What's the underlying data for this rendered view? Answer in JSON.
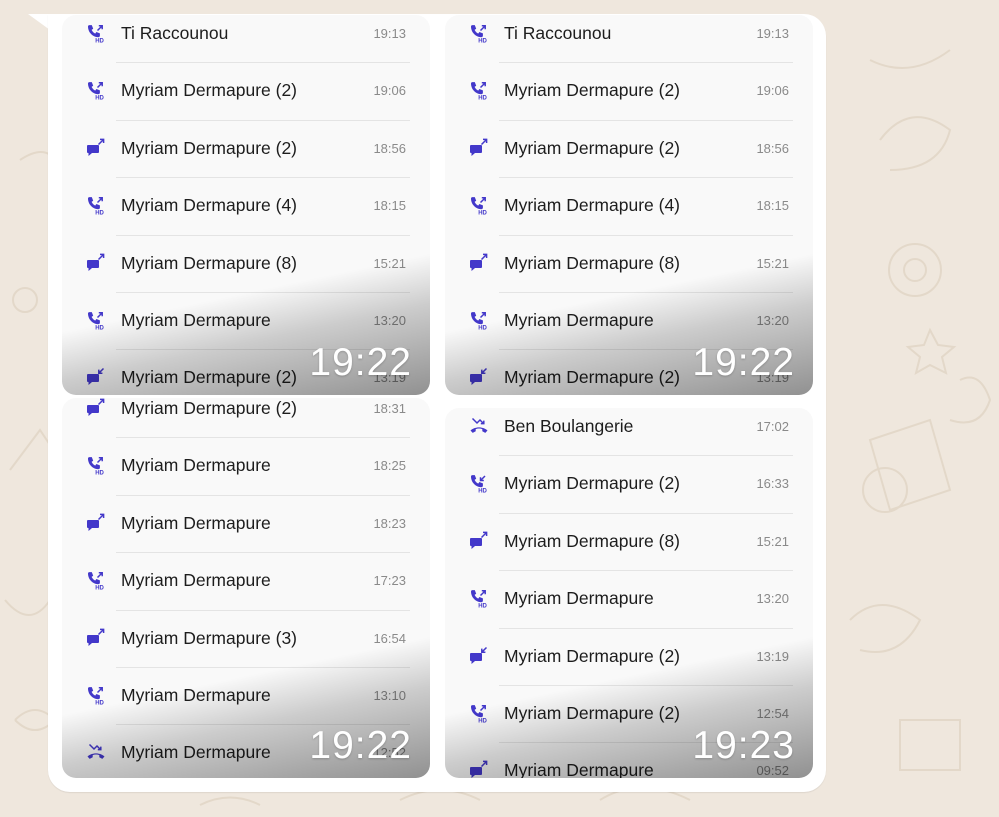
{
  "colors": {
    "accent": "#4338ca",
    "wallpaper": "#efe7dd",
    "bubble": "#ffffff"
  },
  "screenshots": [
    {
      "timestamp": "19:22",
      "rows": [
        {
          "icon": "hd-call-outgoing-icon",
          "name": "Ti Raccounou",
          "time": "19:13"
        },
        {
          "icon": "hd-call-outgoing-icon",
          "name": "Myriam Dermapure (2)",
          "time": "19:06"
        },
        {
          "icon": "message-outgoing-icon",
          "name": "Myriam Dermapure (2)",
          "time": "18:56"
        },
        {
          "icon": "hd-call-outgoing-icon",
          "name": "Myriam Dermapure (4)",
          "time": "18:15"
        },
        {
          "icon": "message-outgoing-icon",
          "name": "Myriam Dermapure (8)",
          "time": "15:21"
        },
        {
          "icon": "hd-call-outgoing-icon",
          "name": "Myriam Dermapure",
          "time": "13:20"
        },
        {
          "icon": "message-incoming-icon",
          "name": "Myriam Dermapure (2)",
          "time": "13:19"
        }
      ]
    },
    {
      "timestamp": "19:22",
      "rows": [
        {
          "icon": "hd-call-outgoing-icon",
          "name": "Ti Raccounou",
          "time": "19:13"
        },
        {
          "icon": "hd-call-outgoing-icon",
          "name": "Myriam Dermapure (2)",
          "time": "19:06"
        },
        {
          "icon": "message-outgoing-icon",
          "name": "Myriam Dermapure (2)",
          "time": "18:56"
        },
        {
          "icon": "hd-call-outgoing-icon",
          "name": "Myriam Dermapure (4)",
          "time": "18:15"
        },
        {
          "icon": "message-outgoing-icon",
          "name": "Myriam Dermapure (8)",
          "time": "15:21"
        },
        {
          "icon": "hd-call-outgoing-icon",
          "name": "Myriam Dermapure",
          "time": "13:20"
        },
        {
          "icon": "message-incoming-icon",
          "name": "Myriam Dermapure (2)",
          "time": "13:19"
        }
      ]
    },
    {
      "timestamp": "19:22",
      "rows": [
        {
          "icon": "message-outgoing-icon",
          "name": "Myriam Dermapure (2)",
          "time": "18:31"
        },
        {
          "icon": "hd-call-outgoing-icon",
          "name": "Myriam Dermapure",
          "time": "18:25"
        },
        {
          "icon": "message-outgoing-icon",
          "name": "Myriam Dermapure",
          "time": "18:23"
        },
        {
          "icon": "hd-call-outgoing-icon",
          "name": "Myriam Dermapure",
          "time": "17:23"
        },
        {
          "icon": "message-outgoing-icon",
          "name": "Myriam Dermapure (3)",
          "time": "16:54"
        },
        {
          "icon": "hd-call-outgoing-icon",
          "name": "Myriam Dermapure",
          "time": "13:10"
        },
        {
          "icon": "missed-call-icon",
          "name": "Myriam Dermapure",
          "time": "12:52"
        }
      ]
    },
    {
      "timestamp": "19:23",
      "rows": [
        {
          "icon": "missed-call-icon",
          "name": "Ben Boulangerie",
          "time": "17:02"
        },
        {
          "icon": "hd-call-incoming-icon",
          "name": "Myriam Dermapure (2)",
          "time": "16:33"
        },
        {
          "icon": "message-outgoing-icon",
          "name": "Myriam Dermapure (8)",
          "time": "15:21"
        },
        {
          "icon": "hd-call-outgoing-icon",
          "name": "Myriam Dermapure",
          "time": "13:20"
        },
        {
          "icon": "message-incoming-icon",
          "name": "Myriam Dermapure (2)",
          "time": "13:19"
        },
        {
          "icon": "hd-call-outgoing-icon",
          "name": "Myriam Dermapure (2)",
          "time": "12:54"
        },
        {
          "icon": "message-outgoing-icon",
          "name": "Myriam Dermapure",
          "time": "09:52"
        }
      ]
    }
  ]
}
